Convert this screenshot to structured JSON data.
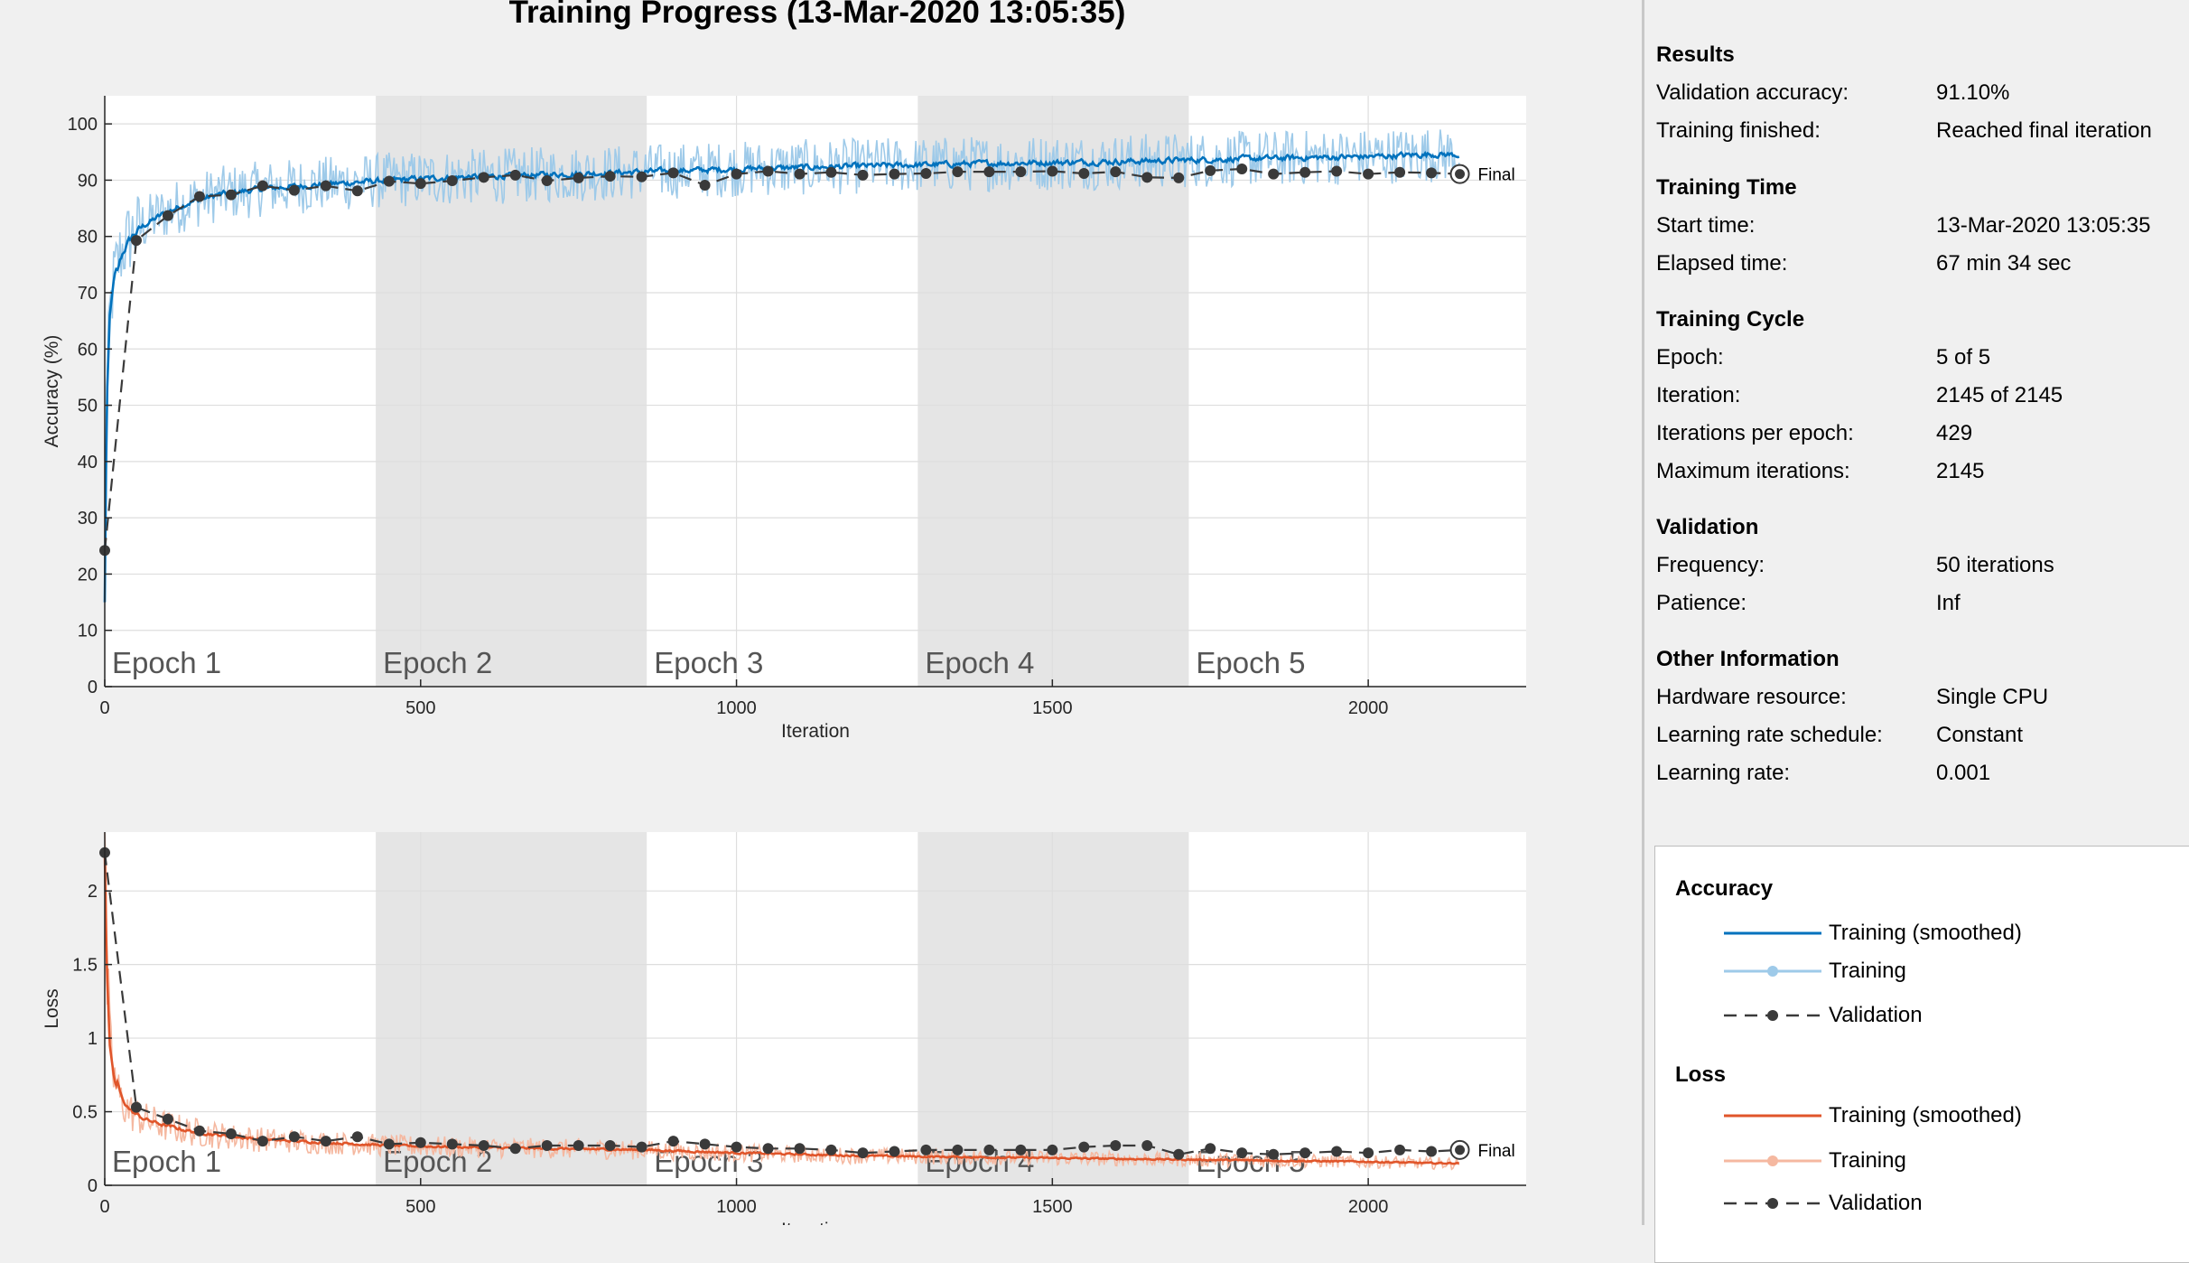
{
  "title": "Training Progress (13-Mar-2020 13:05:35)",
  "colors": {
    "acc_smooth": "#0072BD",
    "acc_raw": "#9ecae9",
    "loss_smooth": "#E0552A",
    "loss_raw": "#f5b8a0",
    "validation": "#3a3a3a",
    "epoch_shade": "#e5e5e5"
  },
  "chart_data": [
    {
      "type": "line",
      "name": "accuracy-plot",
      "ylabel": "Accuracy (%)",
      "xlabel": "Iteration",
      "xlim": [
        0,
        2250
      ],
      "ylim": [
        0,
        105
      ],
      "xticks": [
        0,
        500,
        1000,
        1500,
        2000
      ],
      "yticks": [
        0,
        10,
        20,
        30,
        40,
        50,
        60,
        70,
        80,
        90,
        100
      ],
      "grid": true,
      "epochs": [
        {
          "label": "Epoch 1",
          "start": 0,
          "end": 429
        },
        {
          "label": "Epoch 2",
          "start": 429,
          "end": 858
        },
        {
          "label": "Epoch 3",
          "start": 858,
          "end": 1287
        },
        {
          "label": "Epoch 4",
          "start": 1287,
          "end": 1716
        },
        {
          "label": "Epoch 5",
          "start": 1716,
          "end": 2145
        }
      ],
      "final_label": "Final",
      "smoothed_trend": {
        "x": [
          0,
          3,
          8,
          15,
          25,
          40,
          60,
          90,
          130,
          180,
          250,
          350,
          450,
          550,
          700,
          858,
          1000,
          1200,
          1400,
          1600,
          1800,
          2000,
          2100,
          2145
        ],
        "y": [
          15,
          50,
          66,
          73,
          77,
          80,
          82,
          84,
          86,
          87.5,
          88.5,
          89.3,
          90,
          90.5,
          91,
          91.5,
          92,
          92.5,
          93,
          93.3,
          93.8,
          94.2,
          94.6,
          94.5
        ]
      },
      "validation": {
        "x": [
          0,
          50,
          100,
          150,
          200,
          250,
          300,
          350,
          400,
          450,
          500,
          550,
          600,
          650,
          700,
          750,
          800,
          850,
          900,
          950,
          1000,
          1050,
          1100,
          1150,
          1200,
          1250,
          1300,
          1350,
          1400,
          1450,
          1500,
          1550,
          1600,
          1650,
          1700,
          1750,
          1800,
          1850,
          1900,
          1950,
          2000,
          2050,
          2100,
          2145
        ],
        "y": [
          24.2,
          79.3,
          83.7,
          87.1,
          87.4,
          89,
          88.2,
          89,
          88.1,
          89.8,
          89.4,
          89.9,
          90.5,
          90.9,
          89.9,
          90.4,
          90.7,
          90.6,
          91.3,
          89.1,
          91.1,
          91.6,
          91.1,
          91.4,
          90.9,
          91.1,
          91.2,
          91.5,
          91.5,
          91.5,
          91.6,
          91.2,
          91.5,
          90.5,
          90.4,
          91.7,
          92,
          91.1,
          91.4,
          91.6,
          91.1,
          91.4,
          91.3,
          91.1
        ]
      }
    },
    {
      "type": "line",
      "name": "loss-plot",
      "ylabel": "Loss",
      "xlabel": "Iteration",
      "xlim": [
        0,
        2250
      ],
      "ylim": [
        0,
        2.4
      ],
      "xticks": [
        0,
        500,
        1000,
        1500,
        2000
      ],
      "yticks": [
        0,
        0.5,
        1,
        1.5,
        2
      ],
      "ytick_labels": [
        "0",
        "0.5",
        "1",
        "1.5",
        "2"
      ],
      "grid": true,
      "epochs": [
        {
          "label": "Epoch 1",
          "start": 0,
          "end": 429
        },
        {
          "label": "Epoch 2",
          "start": 429,
          "end": 858
        },
        {
          "label": "Epoch 3",
          "start": 858,
          "end": 1287
        },
        {
          "label": "Epoch 4",
          "start": 1287,
          "end": 1716
        },
        {
          "label": "Epoch 5",
          "start": 1716,
          "end": 2145
        }
      ],
      "final_label": "Final",
      "smoothed_trend": {
        "x": [
          0,
          3,
          8,
          15,
          25,
          40,
          60,
          90,
          130,
          180,
          250,
          350,
          450,
          550,
          700,
          858,
          1000,
          1200,
          1400,
          1600,
          1800,
          2000,
          2100,
          2145
        ],
        "y": [
          2.25,
          1.5,
          0.95,
          0.72,
          0.58,
          0.5,
          0.45,
          0.41,
          0.37,
          0.34,
          0.31,
          0.29,
          0.27,
          0.26,
          0.25,
          0.24,
          0.22,
          0.2,
          0.19,
          0.18,
          0.17,
          0.16,
          0.15,
          0.15
        ]
      },
      "validation": {
        "x": [
          0,
          50,
          100,
          150,
          200,
          250,
          300,
          350,
          400,
          450,
          500,
          550,
          600,
          650,
          700,
          750,
          800,
          850,
          900,
          950,
          1000,
          1050,
          1100,
          1150,
          1200,
          1250,
          1300,
          1350,
          1400,
          1450,
          1500,
          1550,
          1600,
          1650,
          1700,
          1750,
          1800,
          1850,
          1900,
          1950,
          2000,
          2050,
          2100,
          2145
        ],
        "y": [
          2.26,
          0.53,
          0.45,
          0.37,
          0.35,
          0.3,
          0.33,
          0.3,
          0.33,
          0.28,
          0.29,
          0.28,
          0.27,
          0.25,
          0.27,
          0.27,
          0.27,
          0.26,
          0.3,
          0.28,
          0.26,
          0.25,
          0.25,
          0.24,
          0.22,
          0.23,
          0.24,
          0.24,
          0.24,
          0.24,
          0.24,
          0.26,
          0.27,
          0.27,
          0.21,
          0.25,
          0.22,
          0.21,
          0.22,
          0.23,
          0.22,
          0.24,
          0.23,
          0.24
        ]
      }
    }
  ],
  "panel": {
    "sections": [
      {
        "title": "Results",
        "rows": [
          {
            "k": "Validation accuracy:",
            "v": "91.10%"
          },
          {
            "k": "Training finished:",
            "v": "Reached final iteration"
          }
        ]
      },
      {
        "title": "Training Time",
        "rows": [
          {
            "k": "Start time:",
            "v": "13-Mar-2020 13:05:35"
          },
          {
            "k": "Elapsed time:",
            "v": "67 min 34 sec"
          }
        ]
      },
      {
        "title": "Training Cycle",
        "rows": [
          {
            "k": "Epoch:",
            "v": "5 of 5"
          },
          {
            "k": "Iteration:",
            "v": "2145 of 2145"
          },
          {
            "k": "Iterations per epoch:",
            "v": "429"
          },
          {
            "k": "Maximum iterations:",
            "v": "2145"
          }
        ]
      },
      {
        "title": "Validation",
        "rows": [
          {
            "k": "Frequency:",
            "v": "50 iterations"
          },
          {
            "k": "Patience:",
            "v": "Inf"
          }
        ]
      },
      {
        "title": "Other Information",
        "rows": [
          {
            "k": "Hardware resource:",
            "v": "Single CPU"
          },
          {
            "k": "Learning rate schedule:",
            "v": "Constant"
          },
          {
            "k": "Learning rate:",
            "v": "0.001"
          }
        ]
      }
    ]
  },
  "legend": {
    "accuracy_title": "Accuracy",
    "loss_title": "Loss",
    "smoothed": "Training (smoothed)",
    "training": "Training",
    "validation": "Validation"
  }
}
